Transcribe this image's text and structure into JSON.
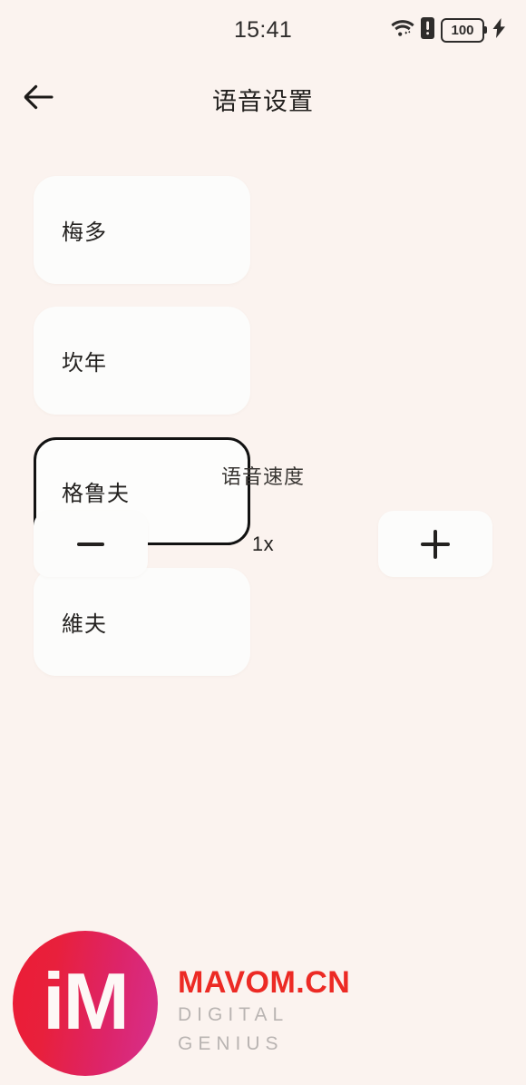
{
  "status_bar": {
    "time": "15:41",
    "battery_percent": "100",
    "icons": [
      "wifi-icon",
      "sim-alert-icon",
      "battery-icon",
      "charging-bolt-icon"
    ]
  },
  "header": {
    "back_icon": "back-arrow-icon",
    "title": "语音设置"
  },
  "voice_options": {
    "selected_index": 2,
    "items": [
      {
        "label": "梅多",
        "selected": false
      },
      {
        "label": "坎年",
        "selected": false
      },
      {
        "label": "格鲁夫",
        "selected": true
      },
      {
        "label": "維夫",
        "selected": false
      }
    ]
  },
  "speed": {
    "title": "语音速度",
    "value": "1x",
    "decrease_icon": "minus-icon",
    "increase_icon": "plus-icon"
  },
  "watermark": {
    "logo_text": "iM",
    "brand": "MAVOM.CN",
    "tagline": "DIGITAL GENIUS"
  },
  "colors": {
    "background": "#fbf3ef",
    "card": "#fcfcfb",
    "selected_border": "#121212",
    "text_primary": "#23211f",
    "brand_red": "#ec2a24",
    "tagline_gray": "#b9b4b2"
  }
}
